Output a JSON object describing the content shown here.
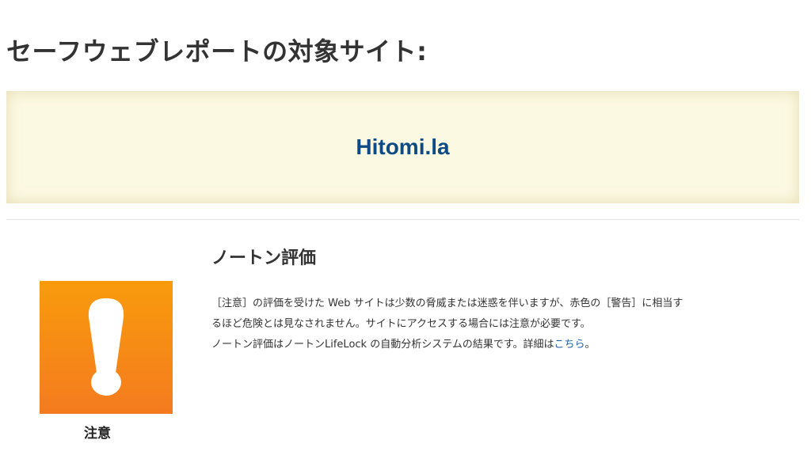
{
  "page": {
    "title": "セーフウェブレポートの対象サイト:"
  },
  "site": {
    "name": "Hitomi.la"
  },
  "rating": {
    "heading": "ノートン評価",
    "badge_label": "注意",
    "badge_icon": "exclamation-icon",
    "badge_color": "#f7891a",
    "description_line1": "［注意］の評価を受けた Web サイトは少数の脅威または迷惑を伴いますが、赤色の［警告］に相当す",
    "description_line2": "るほど危険とは見なされません。サイトにアクセスする場合には注意が必要です。",
    "description_line3_prefix": "ノートン評価はノートンLifeLock の自動分析システムの結果です。詳細は",
    "details_link": "こちら",
    "description_line3_suffix": "。"
  },
  "colors": {
    "site_link": "#0e4a84",
    "banner_background": "#fcf9e3",
    "link": "#1a5ea8"
  }
}
